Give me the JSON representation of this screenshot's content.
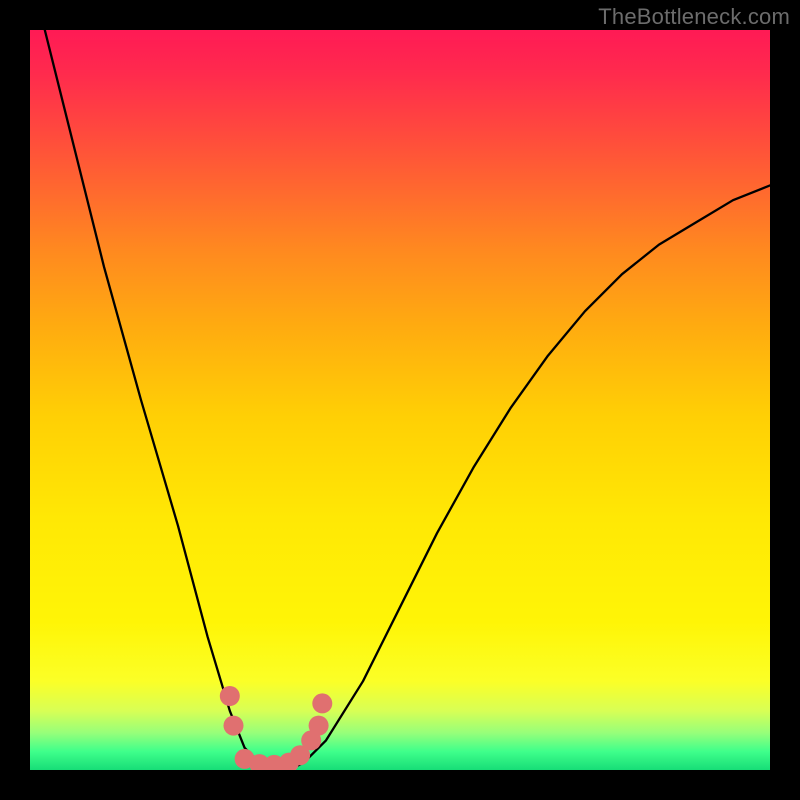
{
  "watermark": "TheBottleneck.com",
  "chart_data": {
    "type": "line",
    "title": "",
    "xlabel": "",
    "ylabel": "",
    "xlim": [
      0,
      100
    ],
    "ylim": [
      0,
      100
    ],
    "series": [
      {
        "name": "bottleneck-curve",
        "x": [
          2,
          5,
          10,
          15,
          20,
          24,
          27,
          29,
          31,
          33,
          35,
          37,
          40,
          45,
          50,
          55,
          60,
          65,
          70,
          75,
          80,
          85,
          90,
          95,
          100
        ],
        "y": [
          100,
          88,
          68,
          50,
          33,
          18,
          8,
          3,
          1,
          0,
          0,
          1,
          4,
          12,
          22,
          32,
          41,
          49,
          56,
          62,
          67,
          71,
          74,
          77,
          79
        ]
      }
    ],
    "markers": [
      {
        "name": "pink-dots",
        "color": "#e07070",
        "points": [
          {
            "x": 27,
            "y": 10
          },
          {
            "x": 27.5,
            "y": 6
          },
          {
            "x": 29,
            "y": 1.5
          },
          {
            "x": 31,
            "y": 0.8
          },
          {
            "x": 33,
            "y": 0.7
          },
          {
            "x": 35,
            "y": 1
          },
          {
            "x": 36.5,
            "y": 2
          },
          {
            "x": 38,
            "y": 4
          },
          {
            "x": 39,
            "y": 6
          },
          {
            "x": 39.5,
            "y": 9
          }
        ]
      }
    ],
    "background_gradient": {
      "top": "#ff1a55",
      "mid": "#ffe805",
      "bottom": "#17dd77"
    }
  }
}
